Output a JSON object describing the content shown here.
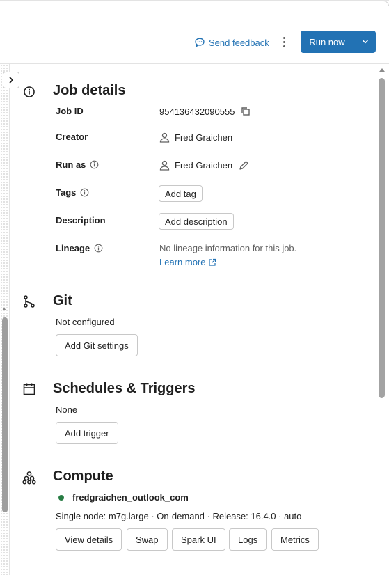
{
  "header": {
    "feedback_label": "Send feedback",
    "run_now_label": "Run now"
  },
  "job_details": {
    "title": "Job details",
    "job_id_label": "Job ID",
    "job_id_value": "954136432090555",
    "creator_label": "Creator",
    "creator_value": "Fred Graichen",
    "run_as_label": "Run as",
    "run_as_value": "Fred Graichen",
    "tags_label": "Tags",
    "add_tag_label": "Add tag",
    "description_label": "Description",
    "add_description_label": "Add description",
    "lineage_label": "Lineage",
    "lineage_text": "No lineage information for this job.",
    "learn_more_label": "Learn more"
  },
  "git": {
    "title": "Git",
    "status": "Not configured",
    "add_button_label": "Add Git settings"
  },
  "schedules": {
    "title": "Schedules & Triggers",
    "status": "None",
    "add_button_label": "Add trigger"
  },
  "compute": {
    "title": "Compute",
    "cluster_name": "fredgraichen_outlook_com",
    "cluster_status_color": "#277c43",
    "cluster_details": "Single node: m7g.large · On-demand · Release: 16.4.0 · auto",
    "buttons": [
      "View details",
      "Swap",
      "Spark UI",
      "Logs",
      "Metrics"
    ]
  },
  "colors": {
    "accent": "#2272b4",
    "text": "#1f1f1f",
    "muted": "#5f5f5f"
  },
  "icons": {
    "feedback": "chat-bubble-icon",
    "kebab": "more-vertical-icon",
    "run_dropdown": "chevron-down-icon",
    "expand": "chevron-right-icon",
    "job_details": "info-circle-icon",
    "copy": "copy-icon",
    "user": "user-icon",
    "edit": "pencil-icon",
    "git": "git-branch-icon",
    "schedules": "calendar-icon",
    "compute": "cluster-icon",
    "external_link": "external-link-icon"
  }
}
